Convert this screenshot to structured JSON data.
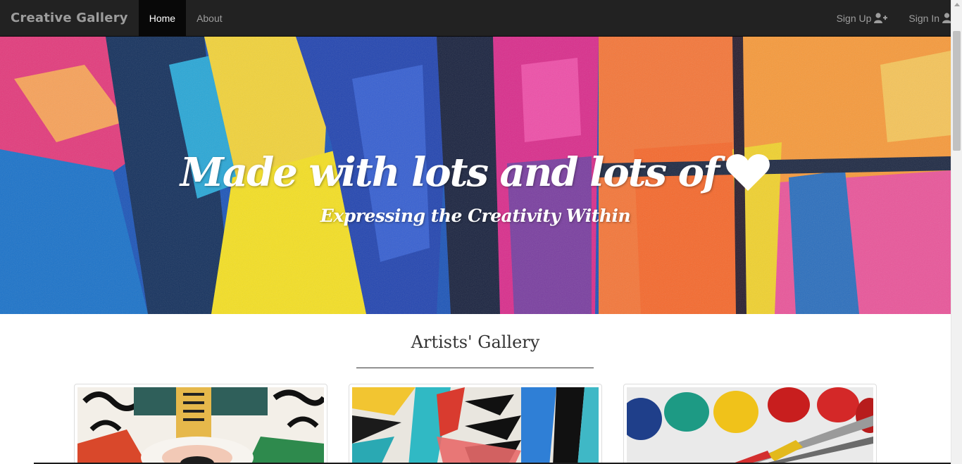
{
  "navbar": {
    "brand": "Creative Gallery",
    "links": [
      {
        "label": "Home",
        "active": true
      },
      {
        "label": "About",
        "active": false
      }
    ],
    "sign_up": {
      "label": "Sign Up",
      "icon": "user-plus-icon"
    },
    "sign_in": {
      "label": "Sign In",
      "icon": "user-icon"
    }
  },
  "hero": {
    "title": "Made with lots and lots of",
    "title_icon": "heart-icon",
    "subtitle": "Expressing the Creativity Within"
  },
  "gallery": {
    "title": "Artists' Gallery",
    "cards": [
      {
        "name": "gallery-card-1"
      },
      {
        "name": "gallery-card-2"
      },
      {
        "name": "gallery-card-3"
      }
    ]
  },
  "colors": {
    "navbar_bg": "#222222",
    "navbar_active_bg": "#080808",
    "nav_text": "#9d9d9d",
    "hero_text": "#ffffff"
  }
}
